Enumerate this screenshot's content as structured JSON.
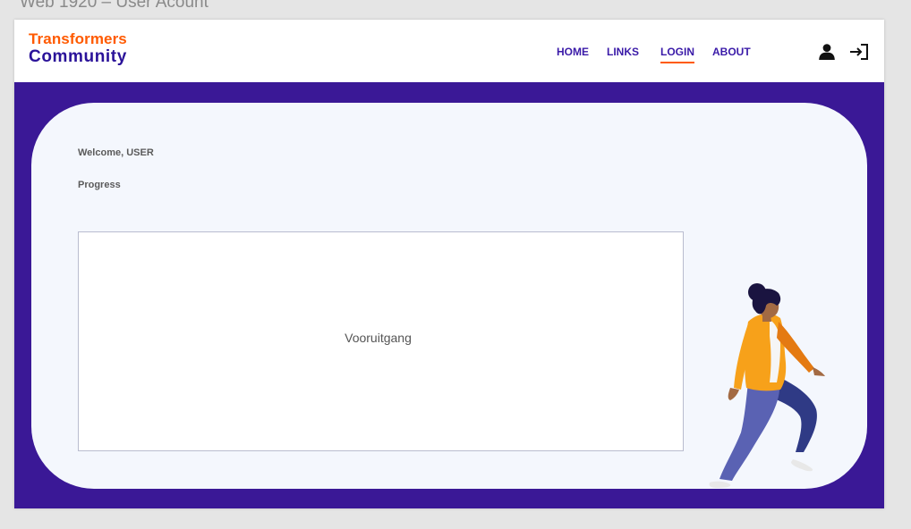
{
  "frame": {
    "title": "Web 1920 – User Acount"
  },
  "header": {
    "logo": {
      "line1": "Transformers",
      "line2": "Community"
    },
    "nav": [
      {
        "label": "HOME",
        "active": false
      },
      {
        "label": "LINKS",
        "active": false
      },
      {
        "label": "LOGIN",
        "active": true
      },
      {
        "label": "ABOUT",
        "active": false
      }
    ],
    "icons": [
      "user-icon",
      "login-icon"
    ]
  },
  "main": {
    "welcome": "Welcome, USER",
    "progress_label": "Progress",
    "progress_box_text": "Vooruitgang"
  },
  "colors": {
    "accent_orange": "#ff5a00",
    "brand_purple": "#2a1299",
    "hero_background": "#3a1896",
    "card_background": "#f4f7fd"
  }
}
